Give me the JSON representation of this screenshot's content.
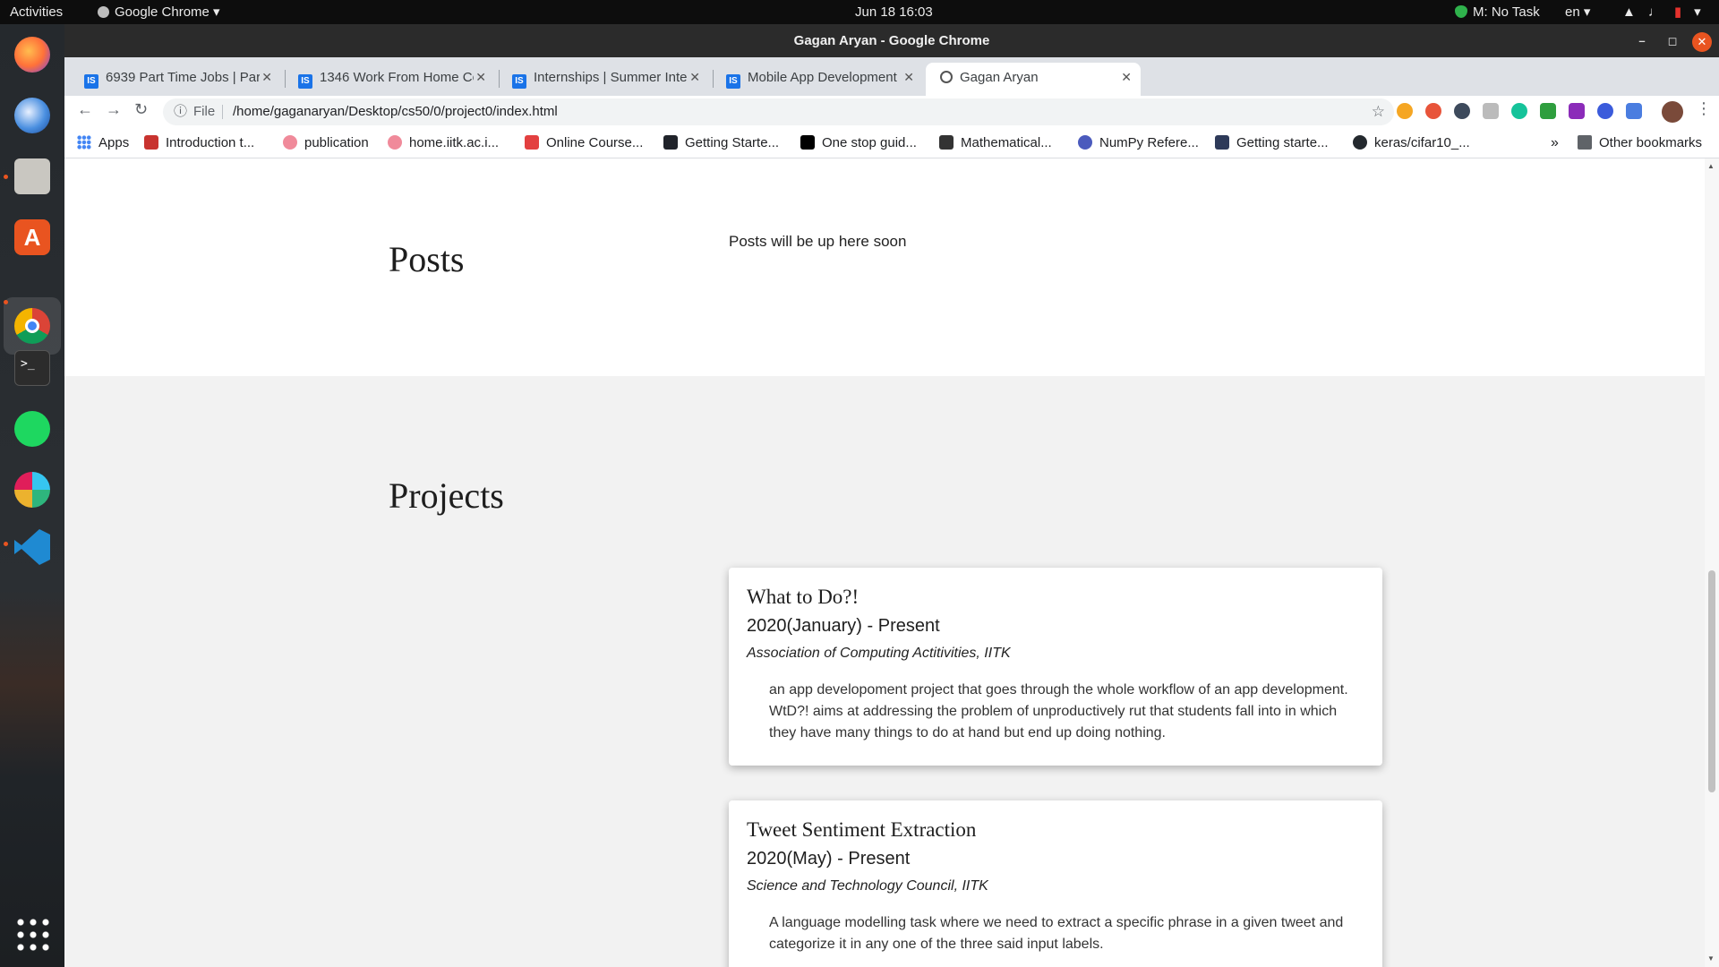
{
  "topbar": {
    "activities": "Activities",
    "app_name": "Google Chrome ▾",
    "clock": "Jun 18  16:03",
    "task": "M: No Task",
    "lang": "en ▾"
  },
  "window": {
    "title": "Gagan Aryan - Google Chrome"
  },
  "tabs": [
    {
      "label": "6939 Part Time Jobs | Part",
      "favicon": "IS"
    },
    {
      "label": "1346 Work From Home Co",
      "favicon": "IS"
    },
    {
      "label": "Internships | Summer Inte",
      "favicon": "IS"
    },
    {
      "label": "Mobile App Development",
      "favicon": "IS"
    },
    {
      "label": "Gagan Aryan",
      "favicon": "globe-icon"
    }
  ],
  "omnibox": {
    "scheme": "File",
    "url": "/home/gaganaryan/Desktop/cs50/0/project0/index.html"
  },
  "bookmarks": [
    {
      "label": "Apps",
      "icon": "apps-grid-icon"
    },
    {
      "label": "Introduction t...",
      "icon": "red-book-icon"
    },
    {
      "label": "publication",
      "icon": "pink-circle-icon"
    },
    {
      "label": "home.iitk.ac.i...",
      "icon": "pink-circle-icon"
    },
    {
      "label": "Online Course...",
      "icon": "red-logo-icon"
    },
    {
      "label": "Getting Starte...",
      "icon": "atom-icon"
    },
    {
      "label": "One stop guid...",
      "icon": "medium-icon"
    },
    {
      "label": "Mathematical...",
      "icon": "book-icon"
    },
    {
      "label": "NumPy Refere...",
      "icon": "blue-swirl-icon"
    },
    {
      "label": "Getting starte...",
      "icon": "ids-icon"
    },
    {
      "label": "keras/cifar10_...",
      "icon": "github-icon"
    },
    {
      "label": "Other bookmarks",
      "icon": "folder-icon"
    }
  ],
  "bookmarks_overflow": "»",
  "page": {
    "posts": {
      "title": "Posts",
      "text": "Posts will be up here soon"
    },
    "projects": {
      "title": "Projects",
      "items": [
        {
          "name": "What to Do?!",
          "date": "2020(January) - Present",
          "org": "Association of Computing Actitivities, IITK",
          "desc": "an app developoment project that goes through the whole workflow of an app development. WtD?! aims at addressing the problem of unproductively rut that students fall into in which they have many things to do at hand but end up doing nothing."
        },
        {
          "name": "Tweet Sentiment Extraction",
          "date": "2020(May) - Present",
          "org": "Science and Technology Council, IITK",
          "desc": "A language modelling task where we need to extract a specific phrase in a given tweet and categorize it in any one of the three said input labels."
        }
      ]
    }
  },
  "colors": {
    "accent_orange": "#e95420",
    "tab_favicon_blue": "#1a73e8",
    "projects_bg": "#f2f2f2"
  },
  "dock": [
    {
      "name": "firefox-icon"
    },
    {
      "name": "thunderbird-icon"
    },
    {
      "name": "files-icon"
    },
    {
      "name": "software-center-icon"
    },
    {
      "name": "chrome-icon"
    },
    {
      "name": "terminal-icon"
    },
    {
      "name": "spotify-icon"
    },
    {
      "name": "slack-icon"
    },
    {
      "name": "vscode-icon"
    },
    {
      "name": "show-apps-icon"
    }
  ]
}
